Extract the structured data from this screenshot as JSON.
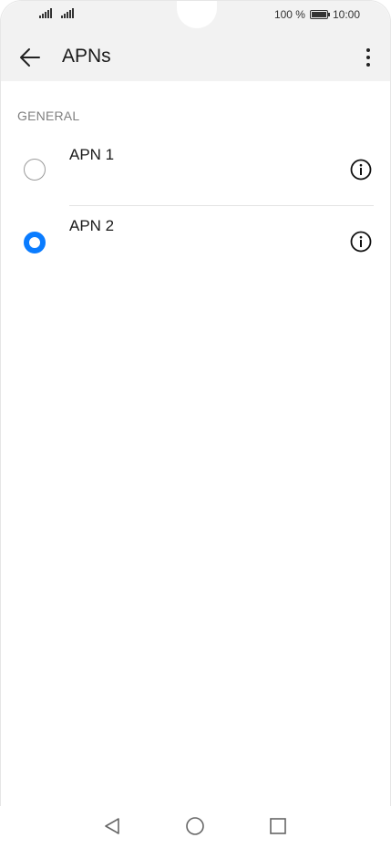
{
  "status_bar": {
    "battery_text": "100 %",
    "time": "10:00",
    "icons": [
      "signal-icon",
      "signal-icon",
      "battery-icon"
    ]
  },
  "toolbar": {
    "title": "APNs",
    "back_icon": "arrow-left-icon",
    "menu_icon": "more-vertical-icon"
  },
  "section": {
    "header": "GENERAL"
  },
  "apns": [
    {
      "name": "APN 1",
      "selected": false
    },
    {
      "name": "APN 2",
      "selected": true
    }
  ],
  "colors": {
    "accent": "#0a7cff",
    "toolbar_bg": "#f2f2f2",
    "section_header": "#808080"
  },
  "nav_bar": {
    "icons": [
      "back-triangle-icon",
      "home-circle-icon",
      "recent-square-icon"
    ]
  }
}
